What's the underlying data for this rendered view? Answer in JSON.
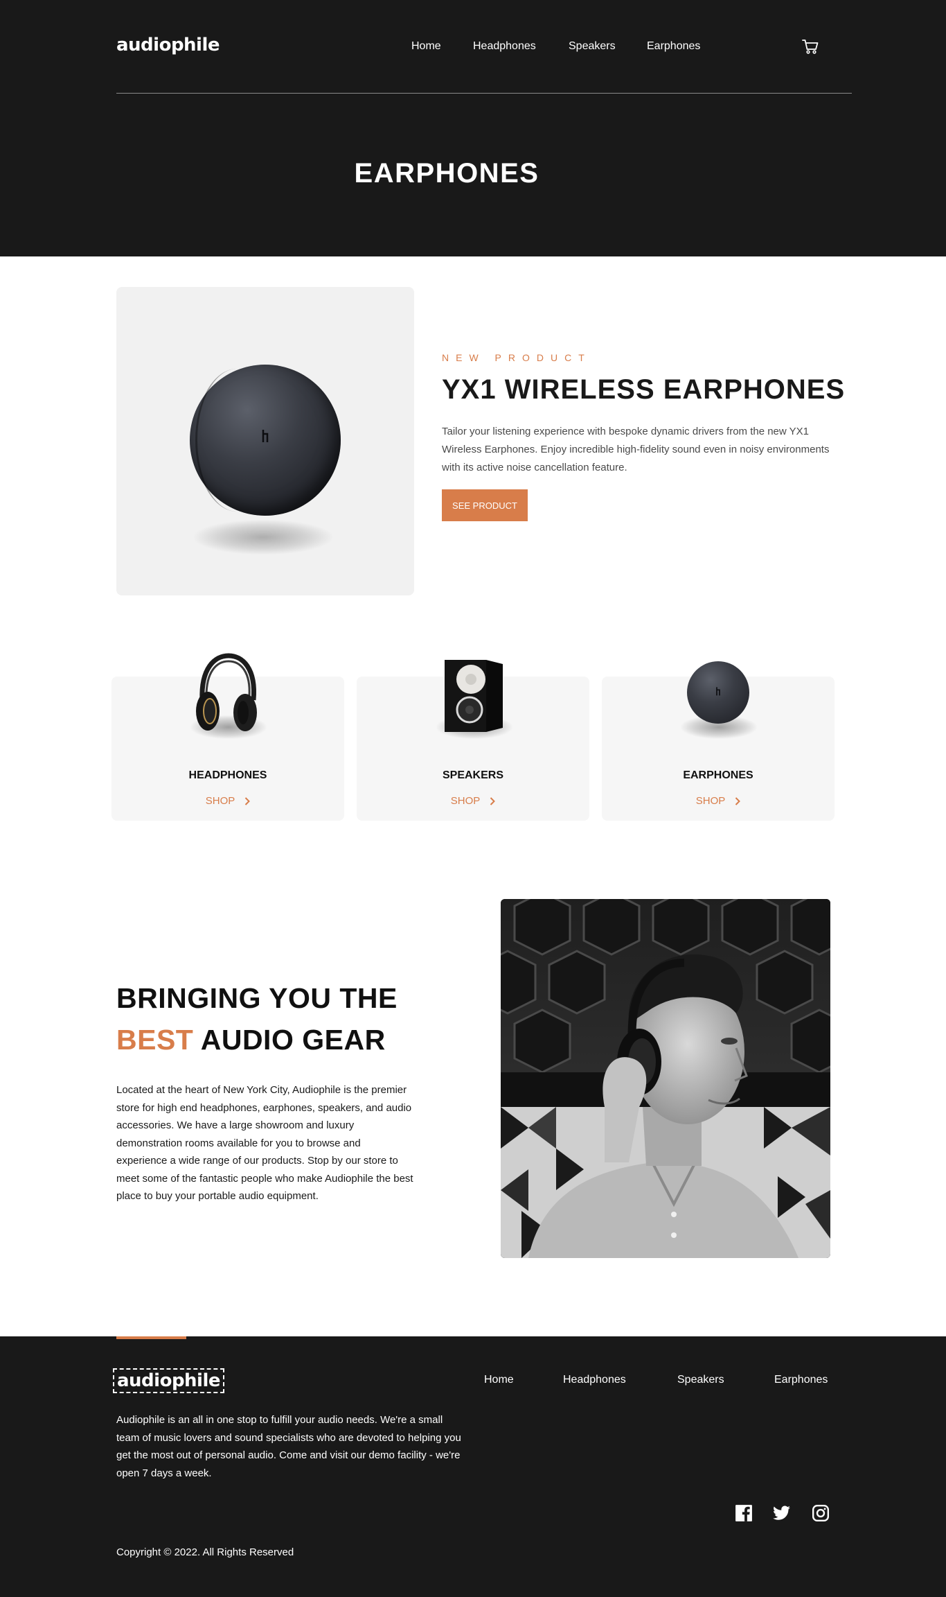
{
  "brand": {
    "logo": "audiophile",
    "accent_color": "#d87d4a",
    "dark_color": "#191919"
  },
  "nav": {
    "items": [
      "Home",
      "Headphones",
      "Speakers",
      "Earphones"
    ],
    "cart_icon": "cart-icon"
  },
  "hero": {
    "title": "EARPHONES"
  },
  "featured": {
    "overline": "NEW PRODUCT",
    "name": "YX1 WIRELESS EARPHONES",
    "description": "Tailor your listening experience with bespoke dynamic drivers from the new YX1 Wireless Earphones. Enjoy incredible high-fidelity sound even in noisy environments with its active noise cancellation feature.",
    "button_label": "SEE PRODUCT"
  },
  "categories": [
    {
      "label": "HEADPHONES",
      "shop_label": "SHOP",
      "icon": "headphones-image"
    },
    {
      "label": "SPEAKERS",
      "shop_label": "SHOP",
      "icon": "speaker-image"
    },
    {
      "label": "EARPHONES",
      "shop_label": "SHOP",
      "icon": "earphones-image"
    }
  ],
  "about": {
    "title_line1": "BRINGING YOU THE",
    "title_accent": "BEST",
    "title_line2_rest": " AUDIO GEAR",
    "text": "Located at the heart of New York City, Audiophile is the premier store for high end headphones, earphones, speakers, and audio accessories. We have a large showroom and luxury demonstration rooms available for you to browse and experience a wide range of our products. Stop by our store to meet some of the fantastic people who make Audiophile the best place to buy your portable audio equipment."
  },
  "footer": {
    "logo": "audiophile",
    "nav": [
      "Home",
      "Headphones",
      "Speakers",
      "Earphones"
    ],
    "text": "Audiophile is an all in one stop to fulfill your audio needs. We're a small team of music lovers and sound specialists who are devoted to helping you get the most out of personal audio. Come and visit our demo facility - we're open 7 days a week.",
    "social": [
      "facebook-icon",
      "twitter-icon",
      "instagram-icon"
    ],
    "copyright": "Copyright © 2022. All Rights Reserved"
  }
}
